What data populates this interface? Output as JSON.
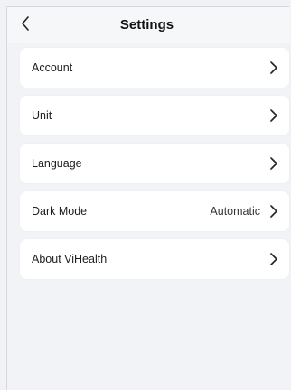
{
  "header": {
    "title": "Settings",
    "back_icon": "chevron-left-icon"
  },
  "settings": {
    "items": [
      {
        "id": "account",
        "label": "Account",
        "value": ""
      },
      {
        "id": "unit",
        "label": "Unit",
        "value": ""
      },
      {
        "id": "language",
        "label": "Language",
        "value": ""
      },
      {
        "id": "dark-mode",
        "label": "Dark Mode",
        "value": "Automatic"
      },
      {
        "id": "about",
        "label": "About ViHealth",
        "value": ""
      }
    ],
    "chevron_icon": "chevron-right-icon"
  },
  "colors": {
    "background": "#f2f3f6",
    "card": "#ffffff",
    "text": "#1c1c1c"
  }
}
